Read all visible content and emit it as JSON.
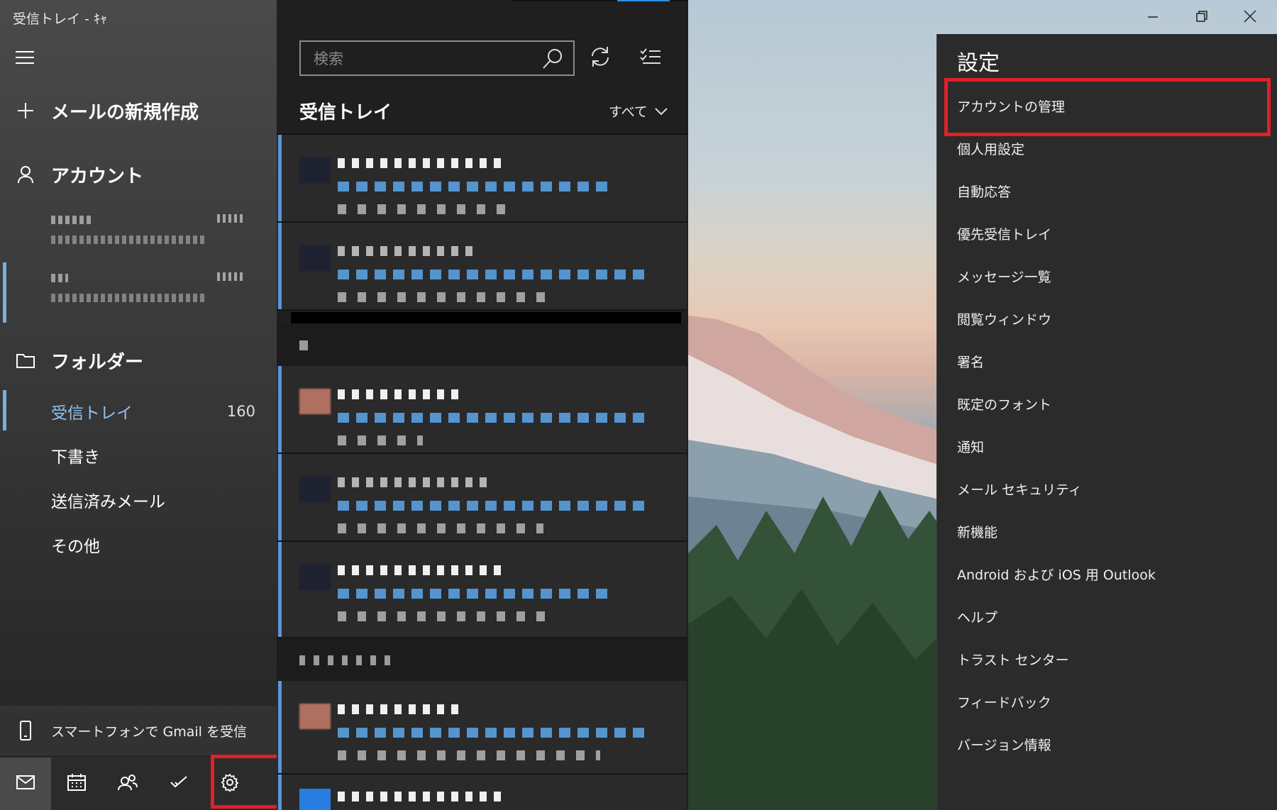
{
  "window": {
    "title": "受信トレイ - ｷｬ"
  },
  "nav": {
    "compose_label": "メールの新規作成",
    "account_label": "アカウント",
    "folders_label": "フォルダー",
    "folders": [
      {
        "label": "受信トレイ",
        "count": "160"
      },
      {
        "label": "下書き"
      },
      {
        "label": "送信済みメール"
      },
      {
        "label": "その他"
      }
    ],
    "phone_promo": "スマートフォンで Gmail を受信"
  },
  "list": {
    "search_placeholder": "検索",
    "title": "受信トレイ",
    "filter_label": "すべて"
  },
  "settings": {
    "title": "設定",
    "items": [
      "アカウントの管理",
      "個人用設定",
      "自動応答",
      "優先受信トレイ",
      "メッセージ一覧",
      "閲覧ウィンドウ",
      "署名",
      "既定のフォント",
      "通知",
      "メール セキュリティ",
      "新機能",
      "Android および iOS 用 Outlook",
      "ヘルプ",
      "トラスト センター",
      "フィードバック",
      "バージョン情報"
    ]
  },
  "colors": {
    "accent": "#5b95d6",
    "highlight": "#e0202b"
  }
}
